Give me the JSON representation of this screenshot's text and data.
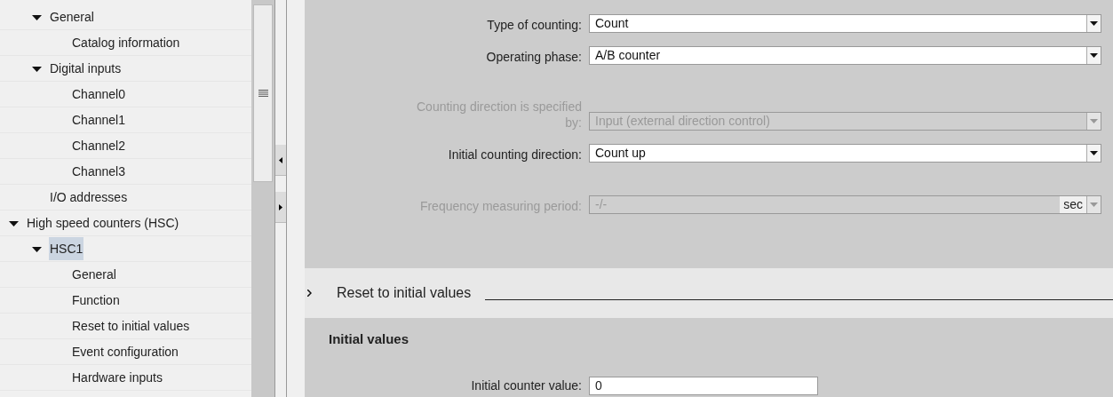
{
  "tree": {
    "partial_branch": [
      {
        "label": "General",
        "expanded": true,
        "selected": false,
        "children": [
          {
            "label": "Catalog information",
            "selected": false
          }
        ]
      },
      {
        "label": "Digital inputs",
        "expanded": true,
        "selected": false,
        "children": [
          {
            "label": "Channel0",
            "selected": false
          },
          {
            "label": "Channel1",
            "selected": false
          },
          {
            "label": "Channel2",
            "selected": false
          },
          {
            "label": "Channel3",
            "selected": false
          }
        ]
      },
      {
        "label": "I/O addresses",
        "selected": false
      }
    ],
    "items": [
      {
        "label": "High speed counters (HSC)",
        "expanded": true,
        "selected": false,
        "children": [
          {
            "label": "HSC1",
            "expanded": true,
            "selected": true,
            "children": [
              {
                "label": "General",
                "selected": false
              },
              {
                "label": "Function",
                "selected": false
              },
              {
                "label": "Reset to initial values",
                "selected": false
              },
              {
                "label": "Event configuration",
                "selected": false
              },
              {
                "label": "Hardware inputs",
                "selected": false
              }
            ]
          }
        ]
      }
    ]
  },
  "settings": {
    "groups": [
      [
        {
          "label": "Type of counting:",
          "value": "Count",
          "disabled": false
        },
        {
          "label": "Operating phase:",
          "value": "A/B counter",
          "disabled": false
        }
      ],
      [
        {
          "label": "Counting direction is specified by:",
          "value": "Input (external direction control)",
          "disabled": true
        },
        {
          "label": "Initial counting direction:",
          "value": "Count up",
          "disabled": false
        }
      ],
      [
        {
          "label": "Frequency measuring period:",
          "value": "-/-",
          "unit": "sec",
          "disabled": true
        }
      ]
    ]
  },
  "section": {
    "title": "Reset to initial values",
    "expanded": false
  },
  "initial_values": {
    "title": "Initial values",
    "fields": [
      {
        "label": "Initial counter value:",
        "value": "0"
      }
    ]
  }
}
